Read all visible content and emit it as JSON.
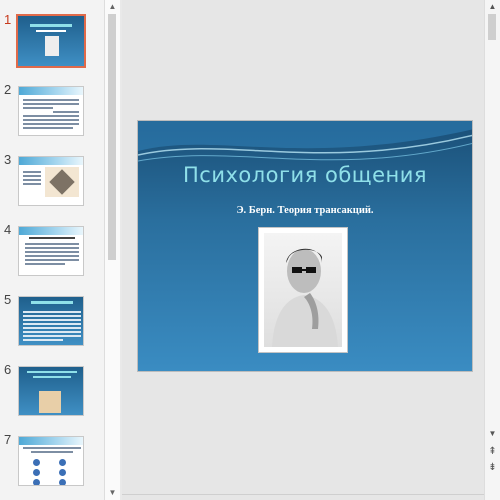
{
  "thumbnails": [
    {
      "number": "1",
      "selected": true
    },
    {
      "number": "2"
    },
    {
      "number": "3"
    },
    {
      "number": "4"
    },
    {
      "number": "5"
    },
    {
      "number": "6"
    },
    {
      "number": "7"
    }
  ],
  "slide": {
    "title": "Психология общения",
    "subtitle": "Э. Берн. Теория трансакций."
  },
  "colors": {
    "accent_selected": "#e06a4a",
    "slide_bg_top": "#1a4f77",
    "slide_bg_bottom": "#3a8cc2",
    "title_color": "#8fe0e9"
  },
  "icons": {
    "scroll_up": "▲",
    "scroll_down": "▼",
    "prev_slide": "⇞",
    "next_slide": "⇟"
  }
}
